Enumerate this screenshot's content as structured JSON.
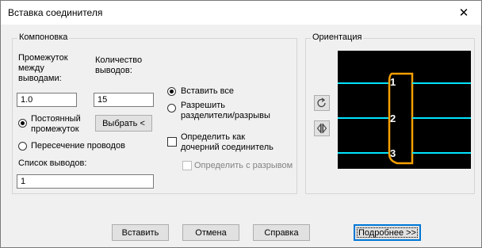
{
  "window": {
    "title": "Вставка соединителя",
    "close_glyph": "✕"
  },
  "layout_group": {
    "title": "Компоновка",
    "spacing_label": [
      "Промежуток",
      "между",
      "выводами:"
    ],
    "count_label": [
      "Количество",
      "выводов:"
    ],
    "spacing_value": "1.0",
    "count_value": "15",
    "radio_fixed_spacing": [
      "Постоянный",
      "промежуток"
    ],
    "pick_button": "Выбрать <",
    "radio_wire_crossing": "Пересечение проводов",
    "pin_list_label": "Список выводов:",
    "pin_list_value": "1",
    "radio_insert_all": "Вставить все",
    "radio_allow_breaks": [
      "Разрешить",
      "разделители/разрывы"
    ],
    "check_child": [
      "Определить как",
      "дочерний соединитель"
    ],
    "check_define_break": "Определить с разрывом"
  },
  "orientation_group": {
    "title": "Ориентация",
    "pins": [
      "1",
      "2",
      "3"
    ],
    "rotate_icon": "rotate-icon",
    "flip_icon": "flip-icon",
    "colors": {
      "background": "#000000",
      "wire": "#00e5ff",
      "connector": "#f5a000",
      "pin_text": "#ffffff"
    }
  },
  "buttons": {
    "insert": "Вставить",
    "cancel": "Отмена",
    "help": "Справка",
    "details": "Подробнее >>"
  }
}
